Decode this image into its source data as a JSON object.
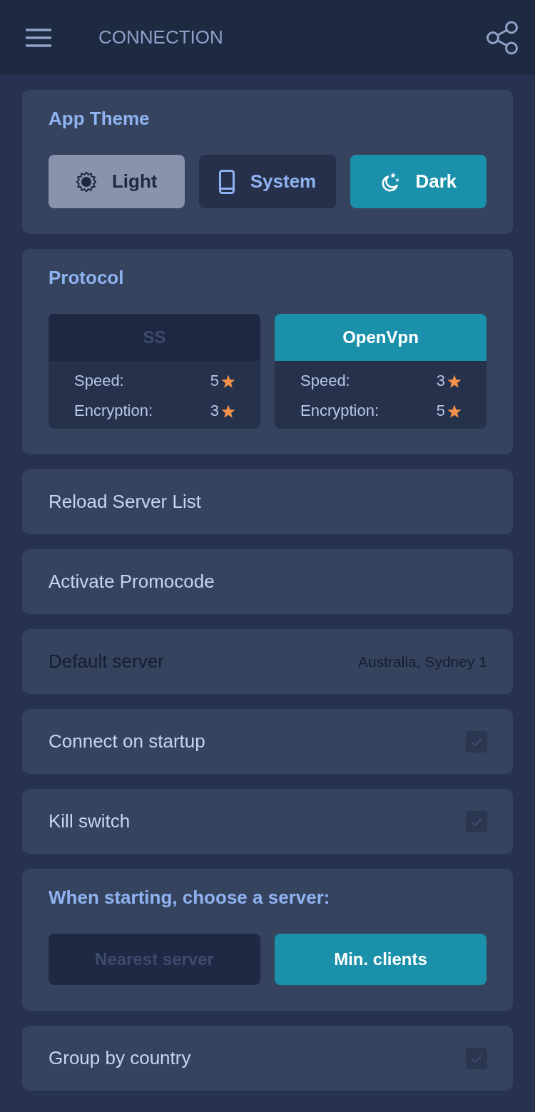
{
  "header": {
    "title": "CONNECTION"
  },
  "theme": {
    "title": "App Theme",
    "options": [
      {
        "kind": "light",
        "label": "Light",
        "selected": false
      },
      {
        "kind": "system",
        "label": "System",
        "selected": false
      },
      {
        "kind": "dark",
        "label": "Dark",
        "selected": true
      }
    ]
  },
  "protocol": {
    "title": "Protocol",
    "options": [
      {
        "name": "SS",
        "selected": false,
        "stats": [
          {
            "label": "Speed:",
            "value": "5"
          },
          {
            "label": "Encryption:",
            "value": "3"
          }
        ]
      },
      {
        "name": "OpenVpn",
        "selected": true,
        "stats": [
          {
            "label": "Speed:",
            "value": "3"
          },
          {
            "label": "Encryption:",
            "value": "5"
          }
        ]
      }
    ]
  },
  "settings": [
    {
      "kind": "action",
      "label": "Reload Server List",
      "disabled": false
    },
    {
      "kind": "action",
      "label": "Activate Promocode",
      "disabled": false
    },
    {
      "kind": "value",
      "label": "Default server",
      "value": "Australia, Sydney 1",
      "disabled": true
    },
    {
      "kind": "checkbox",
      "label": "Connect on startup",
      "checked": false,
      "disabled": false
    },
    {
      "kind": "checkbox",
      "label": "Kill switch",
      "checked": false,
      "disabled": false
    },
    {
      "kind": "choice",
      "title": "When starting, choose a server:",
      "disabled": false,
      "options": [
        {
          "label": "Nearest server",
          "selected": false
        },
        {
          "label": "Min. clients",
          "selected": true
        }
      ]
    },
    {
      "kind": "checkbox",
      "label": "Group by country",
      "checked": false,
      "disabled": false
    }
  ]
}
